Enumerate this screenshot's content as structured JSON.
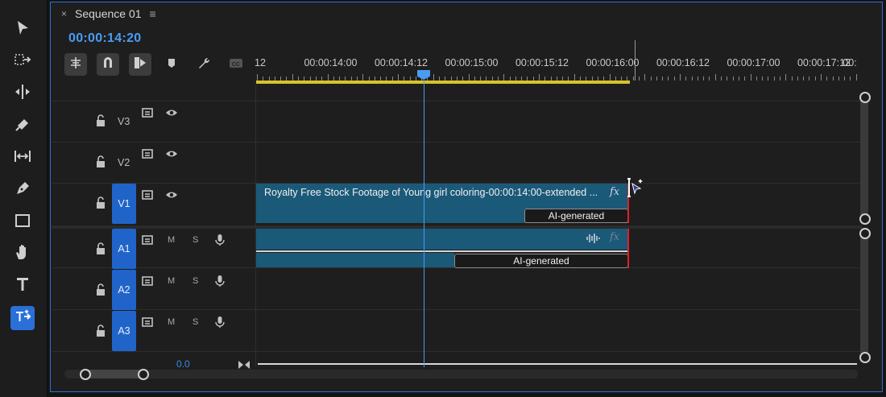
{
  "tools": [
    {
      "name": "selection-tool",
      "icon": "arrow-icon"
    },
    {
      "name": "track-select-tool",
      "icon": "track-select-icon"
    },
    {
      "name": "ripple-edit-tool",
      "icon": "ripple-edit-icon"
    },
    {
      "name": "razor-tool",
      "icon": "razor-icon"
    },
    {
      "name": "slip-tool",
      "icon": "slip-icon"
    },
    {
      "name": "pen-tool",
      "icon": "pen-icon"
    },
    {
      "name": "rectangle-tool",
      "icon": "rectangle-icon"
    },
    {
      "name": "hand-tool",
      "icon": "hand-icon"
    },
    {
      "name": "type-tool",
      "icon": "type-icon"
    },
    {
      "name": "generative-extend-tool",
      "icon": "generative-extend-icon",
      "active": true
    }
  ],
  "sequence": {
    "tab_close": "×",
    "tab_title": "Sequence 01",
    "tab_menu": "≡",
    "timecode": "00:00:14:20"
  },
  "ruler": {
    "labels": [
      "12",
      "00:00:14:00",
      "00:00:14:12",
      "00:00:15:00",
      "00:00:15:12",
      "00:00:16:00",
      "00:00:16:12",
      "00:00:17:00",
      "00:00:17:12",
      "00:"
    ]
  },
  "tracks": {
    "video": [
      {
        "name": "V3",
        "targeted": false
      },
      {
        "name": "V2",
        "targeted": false
      },
      {
        "name": "V1",
        "targeted": true
      }
    ],
    "audio": [
      {
        "name": "A1",
        "mute": "M",
        "solo": "S"
      },
      {
        "name": "A2",
        "mute": "M",
        "solo": "S"
      },
      {
        "name": "A3",
        "mute": "M",
        "solo": "S"
      }
    ]
  },
  "clips": {
    "video_title": "Royalty Free Stock Footage of Young girl coloring-00:00:14:00-extended ...",
    "video_fx": "fx",
    "video_badge": "AI-generated",
    "audio_fx": "fx",
    "audio_badge": "AI-generated"
  },
  "mix": {
    "value": "0.0"
  },
  "colors": {
    "accent": "#2e6fd8",
    "timecode": "#4a9cf2",
    "clip": "#1b5978",
    "work_area": "#d7c32c",
    "clip_end_marker": "#e0202a"
  }
}
